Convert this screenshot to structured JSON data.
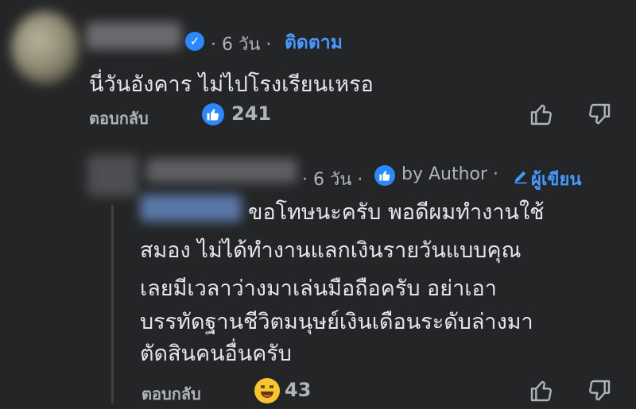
{
  "comment1": {
    "time": "· 6 วัน ·",
    "follow_label": "ติดตาม",
    "text": "นี่วันอังคาร ไม่ไปโรงเรียนเหรอ",
    "reply_label": "ตอบกลับ",
    "like_count": "241"
  },
  "reply": {
    "time": "· 6 วัน ·",
    "by_author": "by Author ·",
    "writer_label": "ผู้เขียน",
    "lines": [
      "ขอโทษนะครับ พอดีผมทำงานใช้",
      "สมอง ไม่ได้ทำงานแลกเงินรายวันแบบคุณ",
      "เลยมีเวลาว่างมาเล่นมือถือครับ อย่าเอา",
      "บรรทัดฐานชีวิตมนุษย์เงินเดือนระดับล่างมา",
      "ตัดสินคนอื่นครับ"
    ],
    "reply_label": "ตอบกลับ",
    "reaction_count": "43"
  },
  "icons": {
    "like": "thumbs-up-icon",
    "dislike": "thumbs-down-icon",
    "verified": "verified-badge-icon",
    "pencil": "pencil-icon",
    "haha": "haha-emoji-icon"
  },
  "colors": {
    "background": "#242526",
    "link": "#4599ff",
    "badge": "#2d88ff",
    "muted": "#b0b3b8",
    "text": "#e4e6eb"
  }
}
